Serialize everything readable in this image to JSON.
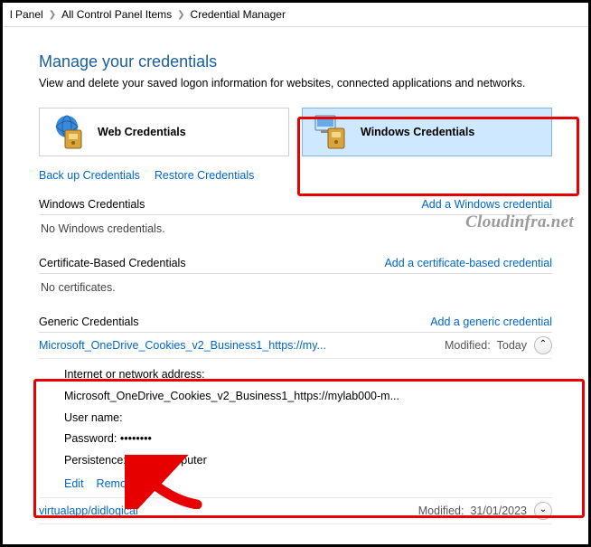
{
  "breadcrumb": {
    "item1": "l Panel",
    "item2": "All Control Panel Items",
    "item3": "Credential Manager"
  },
  "page": {
    "title": "Manage your credentials",
    "description": "View and delete your saved logon information for websites, connected applications and networks."
  },
  "credTypes": {
    "web": "Web Credentials",
    "windows": "Windows Credentials"
  },
  "actions": {
    "backup": "Back up Credentials",
    "restore": "Restore Credentials"
  },
  "sections": {
    "windows": {
      "header": "Windows Credentials",
      "addLink": "Add a Windows credential",
      "empty": "No Windows credentials."
    },
    "cert": {
      "header": "Certificate-Based Credentials",
      "addLink": "Add a certificate-based credential",
      "empty": "No certificates."
    },
    "generic": {
      "header": "Generic Credentials",
      "addLink": "Add a generic credential"
    }
  },
  "credentials": [
    {
      "title": "Microsoft_OneDrive_Cookies_v2_Business1_https://my...",
      "modifiedLabel": "Modified:",
      "modifiedValue": "Today",
      "expanded": true,
      "details": {
        "addressLabel": "Internet or network address:",
        "addressValue": "Microsoft_OneDrive_Cookies_v2_Business1_https://mylab000-m...",
        "userLabel": "User name:",
        "userValue": "",
        "passwordLabel": "Password:",
        "passwordValue": "••••••••",
        "persistLabel": "Persistence:",
        "persistValue": "Local computer"
      },
      "editLabel": "Edit",
      "removeLabel": "Remove"
    },
    {
      "title": "virtualapp/didlogical",
      "modifiedLabel": "Modified:",
      "modifiedValue": "31/01/2023",
      "expanded": false
    }
  ],
  "watermark": "Cloudinfra.net"
}
